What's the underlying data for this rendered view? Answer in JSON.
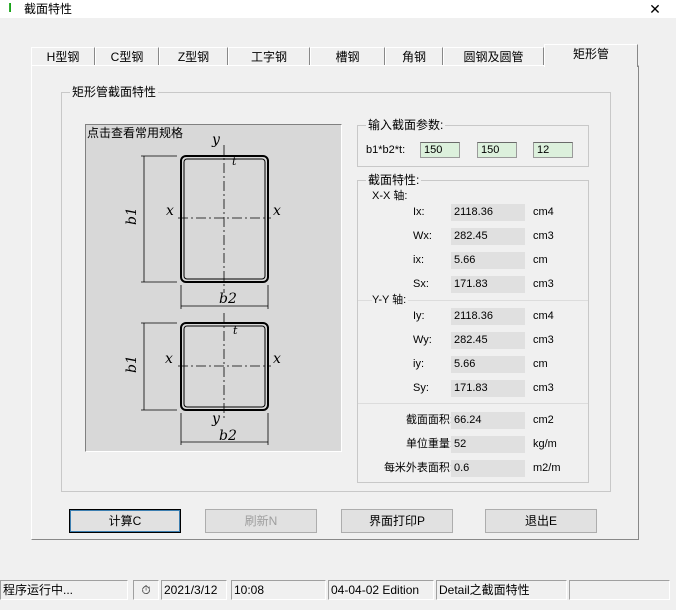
{
  "window": {
    "title": "截面特性",
    "app_icon": "I"
  },
  "tabs": [
    {
      "label": "H型钢"
    },
    {
      "label": "C型钢"
    },
    {
      "label": "Z型钢"
    },
    {
      "label": "工字钢"
    },
    {
      "label": "槽钢"
    },
    {
      "label": "角钢"
    },
    {
      "label": "圆钢及圆管"
    },
    {
      "label": "矩形管"
    }
  ],
  "section_group_title": "矩形管截面特性",
  "drawing": {
    "hint": "点击查看常用规格",
    "labels": {
      "y": "y",
      "x": "x",
      "t": "t",
      "b1": "b1",
      "b2": "b2"
    }
  },
  "input_group": {
    "title": "输入截面参数:",
    "param_label": "b1*b2*t:",
    "values": [
      "150",
      "150",
      "12"
    ]
  },
  "props_group": {
    "title": "截面特性:",
    "xx_axis": "X-X 轴:",
    "yy_axis": "Y-Y 轴:",
    "xx": [
      {
        "name": "Ix:",
        "value": "2118.36",
        "unit": "cm4"
      },
      {
        "name": "Wx:",
        "value": "282.45",
        "unit": "cm3"
      },
      {
        "name": "ix:",
        "value": "5.66",
        "unit": "cm"
      },
      {
        "name": "Sx:",
        "value": "171.83",
        "unit": "cm3"
      }
    ],
    "yy": [
      {
        "name": "Iy:",
        "value": "2118.36",
        "unit": "cm4"
      },
      {
        "name": "Wy:",
        "value": "282.45",
        "unit": "cm3"
      },
      {
        "name": "iy:",
        "value": "5.66",
        "unit": "cm"
      },
      {
        "name": "Sy:",
        "value": "171.83",
        "unit": "cm3"
      }
    ],
    "extra": [
      {
        "name": "截面面积:",
        "value": "66.24",
        "unit": "cm2"
      },
      {
        "name": "单位重量:",
        "value": "52",
        "unit": "kg/m"
      },
      {
        "name": "每米外表面积:",
        "value": "0.6",
        "unit": "m2/m"
      }
    ]
  },
  "buttons": {
    "calc": "计算C",
    "refresh": "刷新N",
    "print": "界面打印P",
    "exit": "退出E"
  },
  "status": {
    "state": "程序运行中...",
    "date": "2021/3/12",
    "time": "10:08",
    "edition": "04-04-02 Edition",
    "module": "Detail之截面特性"
  }
}
